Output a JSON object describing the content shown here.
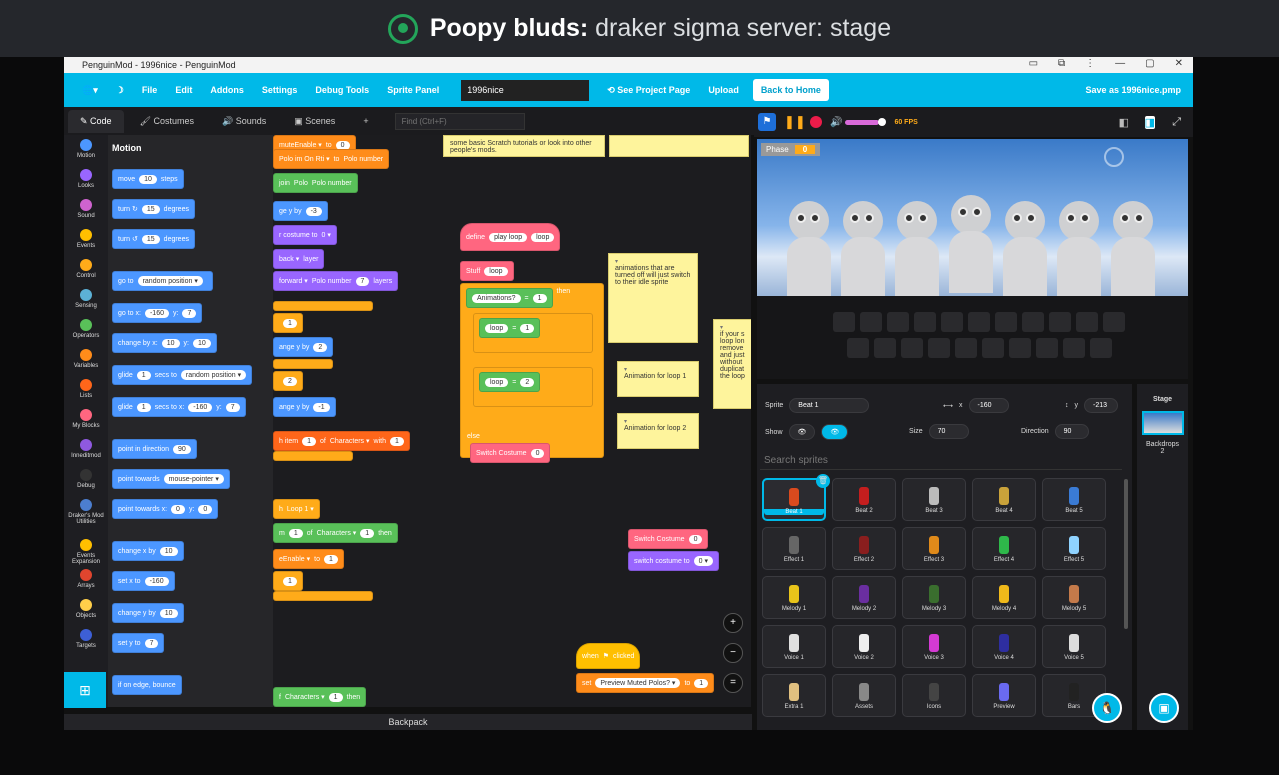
{
  "overlay": {
    "name": "Poopy bluds:",
    "channel": "draker sigma server: stage"
  },
  "window": {
    "title": "PenguinMod - 1996nice - PenguinMod",
    "controls": [
      "▭",
      "⧉",
      "⋮",
      "—",
      "▢",
      "✕"
    ]
  },
  "menu": {
    "items": [
      "File",
      "Edit",
      "Addons",
      "Settings",
      "Debug Tools",
      "Sprite Panel"
    ],
    "project_name": "1996nice",
    "see_project": "See Project Page",
    "upload": "Upload",
    "back_home": "Back to Home",
    "save_as": "Save as 1996nice.pmp"
  },
  "tabs": {
    "code": "Code",
    "costumes": "Costumes",
    "sounds": "Sounds",
    "scenes": "Scenes",
    "find_placeholder": "Find (Ctrl+F)"
  },
  "categories": [
    {
      "label": "Motion",
      "color": "#4c97ff"
    },
    {
      "label": "Looks",
      "color": "#9966ff"
    },
    {
      "label": "Sound",
      "color": "#cf63cf"
    },
    {
      "label": "Events",
      "color": "#ffbf00"
    },
    {
      "label": "Control",
      "color": "#ffab19"
    },
    {
      "label": "Sensing",
      "color": "#5cb1d6"
    },
    {
      "label": "Operators",
      "color": "#59c059"
    },
    {
      "label": "Variables",
      "color": "#ff8c1a"
    },
    {
      "label": "Lists",
      "color": "#ff661a"
    },
    {
      "label": "My Blocks",
      "color": "#ff6680"
    },
    {
      "label": "Inneditmod",
      "color": "#8f59e0"
    },
    {
      "label": "Debug",
      "color": "#333333"
    },
    {
      "label": "Draker's Mod Utilities",
      "color": "#4c7ecf"
    },
    {
      "label": "Events Expansion",
      "color": "#ffbf00"
    },
    {
      "label": "Arrays",
      "color": "#e0452e"
    },
    {
      "label": "Objects",
      "color": "#ffcf4a"
    },
    {
      "label": "Targets",
      "color": "#3d5fd6"
    }
  ],
  "palette": {
    "heading": "Motion",
    "blocks": [
      [
        "move",
        "10",
        "steps"
      ],
      [
        "turn ↻",
        "15",
        "degrees"
      ],
      [
        "turn ↺",
        "15",
        "degrees"
      ],
      [
        "go to",
        "random position ▾",
        ""
      ],
      [
        "go to x:",
        "-160",
        "y:",
        "7"
      ],
      [
        "change by x:",
        "10",
        "y:",
        "10"
      ],
      [
        "glide",
        "1",
        "secs to",
        "random position ▾"
      ],
      [
        "glide",
        "1",
        "secs to x:",
        "-160",
        "y:",
        "7"
      ],
      [
        "point in direction",
        "90"
      ],
      [
        "point towards",
        "mouse-pointer ▾"
      ],
      [
        "point towards x:",
        "0",
        "y:",
        "0"
      ],
      [
        "change x by",
        "10"
      ],
      [
        "set x to",
        "-160"
      ],
      [
        "change y by",
        "10"
      ],
      [
        "set y to",
        "7"
      ],
      [
        "if on edge, bounce"
      ]
    ]
  },
  "workspace": {
    "left_blocks": [
      [
        "muteEnable ▾",
        "to",
        "0"
      ],
      [
        "Polo im On Rti ▾",
        "to",
        "Polo number"
      ],
      [
        "join",
        "Polo",
        "Polo number"
      ],
      [
        "ge y by",
        "-3"
      ],
      [
        "r costume to",
        "0 ▾"
      ],
      [
        "back ▾",
        "layer"
      ],
      [
        "forward ▾",
        "Polo number",
        "7",
        "layers"
      ],
      [
        "",
        "1"
      ],
      [
        "ange y by",
        "2"
      ],
      [
        "",
        "2"
      ],
      [
        "ange y by",
        "-1"
      ],
      [
        "h item",
        "1",
        "of",
        "Characters ▾",
        "with",
        "1"
      ],
      [
        "h",
        "Loop 1 ▾"
      ],
      [
        "m",
        "1",
        "of",
        "Characters ▾",
        "1",
        "then"
      ],
      [
        "eEnable ▾",
        "to",
        "1"
      ],
      [
        "",
        "1"
      ],
      [
        "f",
        "Characters ▾",
        "1",
        "then"
      ]
    ],
    "define": {
      "label": "define",
      "proc": "play loop",
      "arg": "loop",
      "stuff": "Stuff",
      "loop": "loop",
      "if_var": "Animations?",
      "eq": "=",
      "one": "1",
      "then": "then",
      "if1": "if",
      "loop1": "loop",
      "v1": "1",
      "if2": "if",
      "loop2": "loop",
      "v2": "2",
      "else": "else",
      "switch": "Switch Costume",
      "sc_val": "0"
    },
    "mid_blocks": [
      [
        "Switch Costume",
        "0"
      ],
      [
        "switch costume to",
        "0 ▾"
      ]
    ],
    "hat": {
      "when": "when",
      "flag": "⚑",
      "clicked": "clicked",
      "set": "set",
      "var": "Preview Muted Polos? ▾",
      "to": "to",
      "val": "1"
    },
    "notes": [
      "some basic Scratch tutorials or look into other people's mods.",
      "",
      "animations that are turned off will just switch to their idle sprite",
      "Animation for loop 1",
      "Animation for loop 2",
      "if your s loop lon remove and just without duplicat the loop"
    ],
    "zoom": [
      "+",
      "−",
      "="
    ]
  },
  "backpack": "Backpack",
  "stage": {
    "fps": "60 FPS",
    "phase_label": "Phase",
    "phase_value": "0"
  },
  "sprite_info": {
    "sprite_label": "Sprite",
    "sprite_name": "Beat 1",
    "x_label": "x",
    "x": "-160",
    "y_label": "y",
    "y": "-213",
    "show_label": "Show",
    "size_label": "Size",
    "size": "70",
    "direction_label": "Direction",
    "direction": "90"
  },
  "search_placeholder": "Search sprites",
  "sprites": [
    {
      "name": "Beat 1",
      "color": "#d94a1e"
    },
    {
      "name": "Beat 2",
      "color": "#c41e1e"
    },
    {
      "name": "Beat 3",
      "color": "#bbbbbb"
    },
    {
      "name": "Beat 4",
      "color": "#c9a23a"
    },
    {
      "name": "Beat 5",
      "color": "#3a7bd5"
    },
    {
      "name": "Effect 1",
      "color": "#666666"
    },
    {
      "name": "Effect 2",
      "color": "#8a1e1e"
    },
    {
      "name": "Effect 3",
      "color": "#e08a1a"
    },
    {
      "name": "Effect 4",
      "color": "#2eb84a"
    },
    {
      "name": "Effect 5",
      "color": "#8fd3ff"
    },
    {
      "name": "Melody 1",
      "color": "#e8c41a"
    },
    {
      "name": "Melody 2",
      "color": "#6a2ea0"
    },
    {
      "name": "Melody 3",
      "color": "#3a6e2e"
    },
    {
      "name": "Melody 4",
      "color": "#f0b91a"
    },
    {
      "name": "Melody 5",
      "color": "#c47a4a"
    },
    {
      "name": "Voice 1",
      "color": "#e0e0e0"
    },
    {
      "name": "Voice 2",
      "color": "#eeeeee"
    },
    {
      "name": "Voice 3",
      "color": "#d43ad4"
    },
    {
      "name": "Voice 4",
      "color": "#2e2ea0"
    },
    {
      "name": "Voice 5",
      "color": "#dddddd"
    },
    {
      "name": "Extra 1",
      "color": "#e0c080"
    },
    {
      "name": "Assets",
      "color": "#888888"
    },
    {
      "name": "Icons",
      "color": "#444444"
    },
    {
      "name": "Preview",
      "color": "#6a6af0"
    },
    {
      "name": "Bars",
      "color": "#222222"
    }
  ],
  "stage_panel": {
    "label": "Stage",
    "backdrops_label": "Backdrops",
    "backdrops_count": "2"
  }
}
